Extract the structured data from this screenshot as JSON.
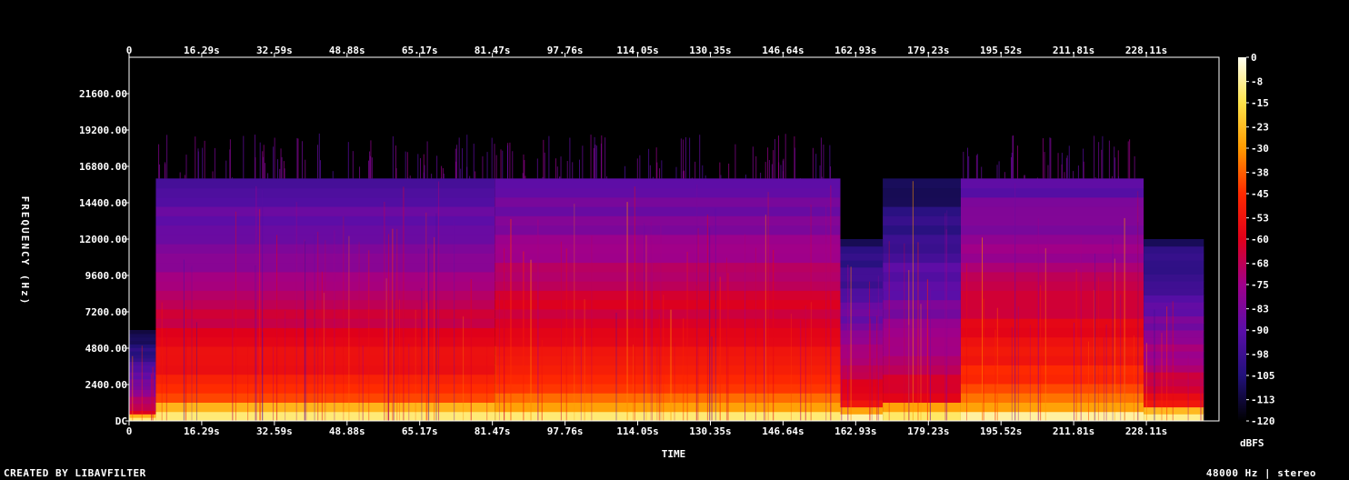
{
  "chart_data": {
    "type": "heatmap",
    "title": "",
    "xlabel": "TIME",
    "ylabel": "FREQUENCY (Hz)",
    "colorbar_label": "dBFS",
    "x_unit": "s",
    "x_ticks": [
      "0",
      "16.29s",
      "32.59s",
      "48.88s",
      "65.17s",
      "81.47s",
      "97.76s",
      "114.05s",
      "130.35s",
      "146.64s",
      "162.93s",
      "179.23s",
      "195.52s",
      "211.81s",
      "228.11s"
    ],
    "x_tick_values": [
      0,
      16.29,
      32.59,
      48.88,
      65.17,
      81.47,
      97.76,
      114.05,
      130.35,
      146.64,
      162.93,
      179.23,
      195.52,
      211.81,
      228.11
    ],
    "xlim": [
      0,
      244.4
    ],
    "y_ticks": [
      "DC",
      "2400.00",
      "4800.00",
      "7200.00",
      "9600.00",
      "12000.00",
      "14400.00",
      "16800.00",
      "19200.00",
      "21600.00"
    ],
    "y_tick_values": [
      0,
      2400,
      4800,
      7200,
      9600,
      12000,
      14400,
      16800,
      19200,
      21600
    ],
    "ylim": [
      0,
      24000
    ],
    "colorbar_ticks": [
      "0",
      "-8",
      "-15",
      "-23",
      "-30",
      "-38",
      "-45",
      "-53",
      "-60",
      "-68",
      "-75",
      "-83",
      "-90",
      "-98",
      "-105",
      "-113",
      "-120"
    ],
    "colorbar_values": [
      0,
      -8,
      -15,
      -23,
      -30,
      -38,
      -45,
      -53,
      -60,
      -68,
      -75,
      -83,
      -90,
      -98,
      -105,
      -113,
      -120
    ],
    "zlim": [
      -120,
      0
    ],
    "colormap": [
      "#fffff0",
      "#ffe34a",
      "#ff9a00",
      "#ff2a00",
      "#e0001a",
      "#a0008a",
      "#5a0ea8",
      "#22117a",
      "#000000"
    ],
    "segments": [
      {
        "start": 0,
        "end": 6,
        "cutoff_hz": 6000,
        "level": 0.35
      },
      {
        "start": 6,
        "end": 82,
        "cutoff_hz": 16000,
        "level": 0.62
      },
      {
        "start": 82,
        "end": 159.5,
        "cutoff_hz": 16000,
        "level": 0.7
      },
      {
        "start": 159.5,
        "end": 169,
        "cutoff_hz": 12000,
        "level": 0.45
      },
      {
        "start": 169,
        "end": 186.5,
        "cutoff_hz": 16000,
        "level": 0.4
      },
      {
        "start": 186.5,
        "end": 227.5,
        "cutoff_hz": 16000,
        "level": 0.7
      },
      {
        "start": 227.5,
        "end": 241,
        "cutoff_hz": 12000,
        "level": 0.45
      }
    ]
  },
  "footer": {
    "left": "CREATED BY LIBAVFILTER",
    "right": "48000 Hz | stereo"
  }
}
